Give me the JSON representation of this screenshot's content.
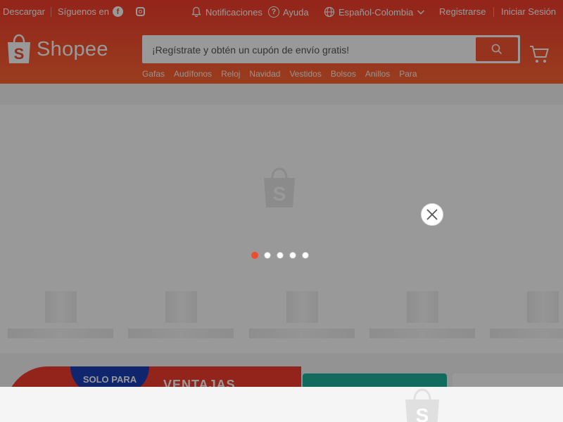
{
  "topbar": {
    "download": "Descargar",
    "follow_us": "Síguenos en",
    "notifications": "Notificaciones",
    "help": "Ayuda",
    "language": "Español-Colombia",
    "register": "Registrarse",
    "login": "Iniciar Sesión"
  },
  "brand": {
    "name": "Shopee",
    "color": "#ee4d2d"
  },
  "search": {
    "placeholder": "¡Regístrate y obtén un cupón de envío gratis!"
  },
  "keywords": [
    "Gafas",
    "Audífonos",
    "Reloj",
    "Navidad",
    "Vestidos",
    "Bolsos",
    "Anillos",
    "Para"
  ],
  "carousel": {
    "total_slides": 5,
    "active_slide": 1
  },
  "promo": {
    "badge": "SOLO PARA",
    "title": "VENTAJAS"
  },
  "icons": {
    "facebook": "facebook-icon",
    "instagram": "instagram-icon",
    "bell": "bell-icon",
    "help": "help-circle-icon",
    "globe": "globe-icon",
    "chevron": "chevron-down-icon",
    "search": "search-icon",
    "cart": "cart-icon",
    "close": "close-icon"
  }
}
